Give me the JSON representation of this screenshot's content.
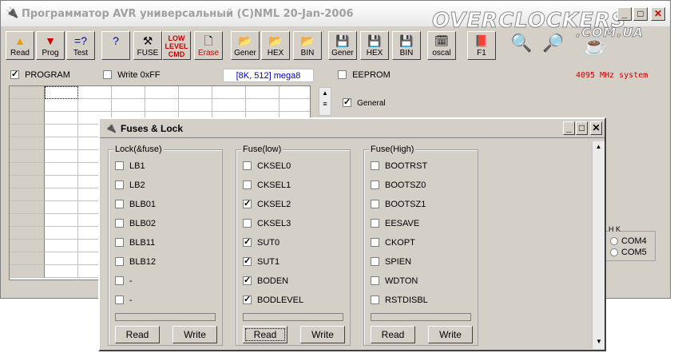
{
  "main_window": {
    "title": "Программатор AVR универсальный (C)NML 20-Jan-2006",
    "watermark": "OVERCLOCKERS",
    "watermark_sub": ".COM.UA"
  },
  "toolbar": {
    "buttons": [
      {
        "label": "Read",
        "icon": "arrow-up-icon"
      },
      {
        "label": "Prog",
        "icon": "arrow-down-icon"
      },
      {
        "label": "Test",
        "icon": "compare-icon"
      },
      {
        "label": "",
        "icon": "help-icon"
      },
      {
        "label": "FUSE",
        "icon": "tools-icon"
      },
      {
        "label": "LOW LEVEL CMD",
        "icon": "low-level-icon"
      },
      {
        "label": "Erase",
        "icon": "erase-icon"
      },
      {
        "label": "Gener",
        "icon": "open-folder-icon"
      },
      {
        "label": "HEX",
        "icon": "open-folder-icon"
      },
      {
        "label": "BIN",
        "icon": "open-folder-icon"
      },
      {
        "label": "Gener",
        "icon": "save-icon"
      },
      {
        "label": "HEX",
        "icon": "save-icon"
      },
      {
        "label": "BIN",
        "icon": "save-icon"
      },
      {
        "label": "oscal",
        "icon": "oscal-icon"
      },
      {
        "label": "F1",
        "icon": "book-icon"
      }
    ]
  },
  "options": {
    "program_label": "PROGRAM",
    "program_checked": true,
    "write0xff_label": "Write 0xFF",
    "write0xff_checked": false,
    "device_info": "[8K, 512]  mega8",
    "eeprom_label": "EEPROM",
    "eeprom_checked": false,
    "speed": "4095 MHz system",
    "general_label": "General",
    "general_checked": true
  },
  "ports": [
    "COM4",
    "COM5"
  ],
  "ports_header": "H K",
  "fuses_dialog": {
    "title": "Fuses & Lock",
    "groups": [
      {
        "legend": "Lock(&fuse)",
        "items": [
          {
            "label": "LB1",
            "checked": false
          },
          {
            "label": "LB2",
            "checked": false
          },
          {
            "label": "BLB01",
            "checked": false
          },
          {
            "label": "BLB02",
            "checked": false
          },
          {
            "label": "BLB11",
            "checked": false
          },
          {
            "label": "BLB12",
            "checked": false
          },
          {
            "label": "-",
            "checked": false
          },
          {
            "label": "-",
            "checked": false
          }
        ],
        "read_label": "Read",
        "write_label": "Write"
      },
      {
        "legend": "Fuse(low)",
        "items": [
          {
            "label": "CKSEL0",
            "checked": false
          },
          {
            "label": "CKSEL1",
            "checked": false
          },
          {
            "label": "CKSEL2",
            "checked": true
          },
          {
            "label": "CKSEL3",
            "checked": false
          },
          {
            "label": "SUT0",
            "checked": true
          },
          {
            "label": "SUT1",
            "checked": true
          },
          {
            "label": "BODEN",
            "checked": true
          },
          {
            "label": "BODLEVEL",
            "checked": true
          }
        ],
        "read_label": "Read",
        "write_label": "Write"
      },
      {
        "legend": "Fuse(High)",
        "items": [
          {
            "label": "BOOTRST",
            "checked": false
          },
          {
            "label": "BOOTSZ0",
            "checked": false
          },
          {
            "label": "BOOTSZ1",
            "checked": false
          },
          {
            "label": "EESAVE",
            "checked": false
          },
          {
            "label": "CKOPT",
            "checked": false
          },
          {
            "label": "SPIEN",
            "checked": false
          },
          {
            "label": "WDTON",
            "checked": false
          },
          {
            "label": "RSTDISBL",
            "checked": false
          }
        ],
        "read_label": "Read",
        "write_label": "Write"
      }
    ]
  }
}
